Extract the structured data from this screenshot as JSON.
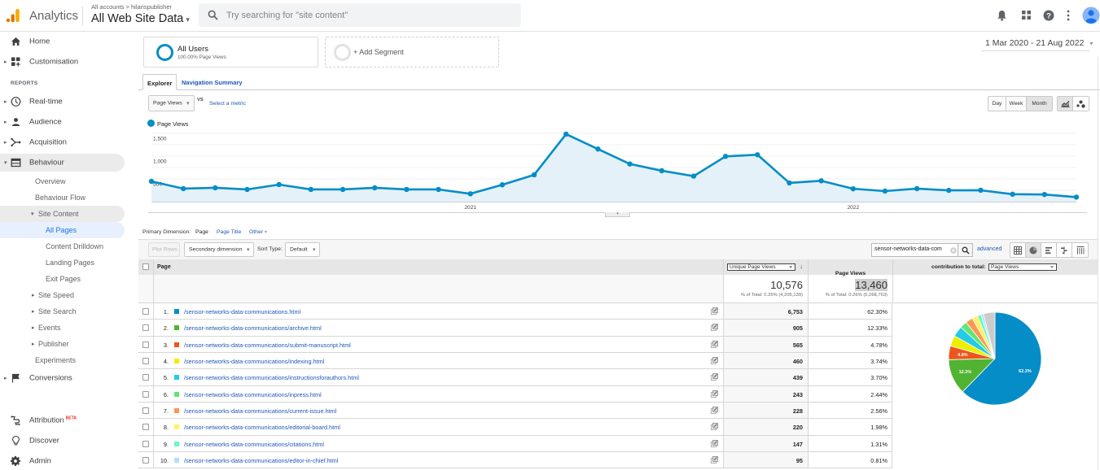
{
  "topbar": {
    "product_name": "Analytics",
    "breadcrumb": "All accounts > hilarispublisher",
    "property_name": "All Web Site Data",
    "search_placeholder": "Try searching for \"site content\"",
    "icons": [
      "bell-icon",
      "apps-icon",
      "help-icon",
      "more-vert-icon",
      "account-avatar"
    ]
  },
  "sidebar": {
    "home": "Home",
    "customisation": "Customisation",
    "reports_heading": "REPORTS",
    "realtime": "Real-time",
    "audience": "Audience",
    "acquisition": "Acquisition",
    "behaviour": "Behaviour",
    "overview": "Overview",
    "behaviour_flow": "Behaviour Flow",
    "site_content": "Site Content",
    "all_pages": "All Pages",
    "content_drilldown": "Content Drilldown",
    "landing_pages": "Landing Pages",
    "exit_pages": "Exit Pages",
    "site_speed": "Site Speed",
    "site_search": "Site Search",
    "events": "Events",
    "publisher": "Publisher",
    "experiments": "Experiments",
    "conversions": "Conversions",
    "attribution": "Attribution",
    "attribution_badge": "BETA",
    "discover": "Discover",
    "admin": "Admin",
    "active_item": "All Pages"
  },
  "segments": {
    "active_name": "All Users",
    "active_detail": "100.00% Page Views",
    "add_label": "+ Add Segment"
  },
  "date_range": "1 Mar 2020 - 21 Aug 2022",
  "tabs": {
    "explorer": "Explorer",
    "navigation_summary": "Navigation Summary",
    "active": "Explorer"
  },
  "chart_controls": {
    "metric": "Page Views",
    "vs": "VS",
    "select_metric": "Select a metric",
    "granularity": [
      "Day",
      "Week",
      "Month"
    ],
    "granularity_selected": "Month",
    "chart_types": [
      "line-chart-icon",
      "motion-chart-icon"
    ],
    "chart_type_selected": "line-chart-icon"
  },
  "chart_data": [
    {
      "type": "line",
      "title": "",
      "xlabel": "",
      "ylabel": "",
      "legend": "top-left",
      "x": [
        "Mar 2020",
        "Apr 2020",
        "May 2020",
        "Jun 2020",
        "Jul 2020",
        "Aug 2020",
        "Sep 2020",
        "Oct 2020",
        "Nov 2020",
        "Dec 2020",
        "Jan 2021",
        "Feb 2021",
        "Mar 2021",
        "Apr 2021",
        "May 2021",
        "Jun 2021",
        "Jul 2021",
        "Aug 2021",
        "Sep 2021",
        "Oct 2021",
        "Nov 2021",
        "Dec 2021",
        "Jan 2022",
        "Feb 2022",
        "Mar 2022",
        "Apr 2022",
        "May 2022",
        "Jun 2022",
        "Jul 2022",
        "Aug 2022"
      ],
      "series": [
        {
          "name": "Page Views",
          "color": "#058dc7",
          "values": [
            446,
            286,
            304,
            268,
            375,
            268,
            268,
            304,
            268,
            268,
            173,
            370,
            589,
            1482,
            1155,
            827,
            679,
            560,
            994,
            1030,
            411,
            458,
            283,
            232,
            286,
            248,
            250,
            164,
            158,
            100
          ]
        }
      ],
      "x_ticks": [
        {
          "label": "2021",
          "at": "Jan 2021"
        },
        {
          "label": "2022",
          "at": "Jan 2022"
        }
      ],
      "y_ticks": [
        {
          "value": 500,
          "label": "500"
        },
        {
          "value": 1000,
          "label": "1,000"
        },
        {
          "value": 1500,
          "label": "1,500"
        }
      ],
      "gridlines": [
        250,
        500,
        750,
        1000,
        1250,
        1500
      ],
      "ylim": [
        0,
        1570
      ],
      "grid": true
    },
    {
      "type": "pie",
      "title": "contribution to total: Page Views",
      "categories": [
        "/sensor-networks-data-communications.html",
        "/sensor-networks-data-communications/archive.html",
        "/sensor-networks-data-communications/submit-manuscript.html",
        "/sensor-networks-data-communications/indexing.html",
        "/sensor-networks-data-communications/instructionsforauthors.html",
        "/sensor-networks-data-communications/inpress.html",
        "/sensor-networks-data-communications/current-issue.html",
        "/sensor-networks-data-communications/editorial-board.html",
        "/sensor-networks-data-communications/citations.html",
        "/sensor-networks-data-communications/editor-in-chief.html",
        "Other"
      ],
      "values": [
        62.3,
        12.33,
        4.78,
        3.74,
        3.7,
        2.44,
        2.56,
        1.98,
        1.31,
        0.81,
        4.05
      ],
      "colors": [
        "#058dc7",
        "#50b432",
        "#ed561b",
        "#edef00",
        "#24cbe5",
        "#64e572",
        "#ff9655",
        "#fff263",
        "#6af9c4",
        "#b2deff",
        "#cccccc"
      ],
      "slice_labels": [
        "62.3%",
        "12.3%",
        "4.8%",
        "",
        "",
        "",
        "",
        "",
        "",
        "",
        ""
      ]
    }
  ],
  "dimension": {
    "label": "Primary Dimension:",
    "selected": "Page",
    "page_title": "Page Title",
    "other": "Other"
  },
  "table_toolbar": {
    "plot_rows": "Plot Rows",
    "secondary_dimension": "Secondary dimension",
    "sort_type_label": "Sort Type:",
    "sort_type": "Default",
    "filter_value": "sensor-networks-data-com",
    "advanced": "advanced",
    "views": [
      "table-view-icon",
      "pie-view-icon",
      "performance-view-icon",
      "comparison-view-icon",
      "pivot-view-icon"
    ],
    "view_selected": "pie-view-icon"
  },
  "table": {
    "columns": {
      "page": "Page",
      "metric1": "Unique Page Views",
      "metric2": "Page Views",
      "contribution_label": "contribution to total:",
      "contribution_metric": "Page Views"
    },
    "totals": {
      "metric1": "10,576",
      "metric1_note": "% of Total: 0.25% (4,205,139)",
      "metric2": "13,460",
      "metric2_note": "% of Total: 0.26% (5,268,763)"
    },
    "rows": [
      {
        "index": "1.",
        "page": "/sensor-networks-data-communications.html",
        "color": "#058dc7",
        "unique_page_views": "6,753",
        "page_views_pct": "62.30%"
      },
      {
        "index": "2.",
        "page": "/sensor-networks-data-communications/archive.html",
        "color": "#50b432",
        "unique_page_views": "905",
        "page_views_pct": "12.33%"
      },
      {
        "index": "3.",
        "page": "/sensor-networks-data-communications/submit-manuscript.html",
        "color": "#ed561b",
        "unique_page_views": "565",
        "page_views_pct": "4.78%"
      },
      {
        "index": "4.",
        "page": "/sensor-networks-data-communications/indexing.html",
        "color": "#edef00",
        "unique_page_views": "460",
        "page_views_pct": "3.74%"
      },
      {
        "index": "5.",
        "page": "/sensor-networks-data-communications/instructionsforauthors.html",
        "color": "#24cbe5",
        "unique_page_views": "439",
        "page_views_pct": "3.70%"
      },
      {
        "index": "6.",
        "page": "/sensor-networks-data-communications/inpress.html",
        "color": "#64e572",
        "unique_page_views": "243",
        "page_views_pct": "2.44%"
      },
      {
        "index": "7.",
        "page": "/sensor-networks-data-communications/current-issue.html",
        "color": "#ff9655",
        "unique_page_views": "228",
        "page_views_pct": "2.56%"
      },
      {
        "index": "8.",
        "page": "/sensor-networks-data-communications/editorial-board.html",
        "color": "#fff263",
        "unique_page_views": "220",
        "page_views_pct": "1.98%"
      },
      {
        "index": "9.",
        "page": "/sensor-networks-data-communications/citations.html",
        "color": "#6af9c4",
        "unique_page_views": "147",
        "page_views_pct": "1.31%"
      },
      {
        "index": "10.",
        "page": "/sensor-networks-data-communications/editor-in-chief.html",
        "color": "#b2deff",
        "unique_page_views": "95",
        "page_views_pct": "0.81%"
      }
    ]
  }
}
